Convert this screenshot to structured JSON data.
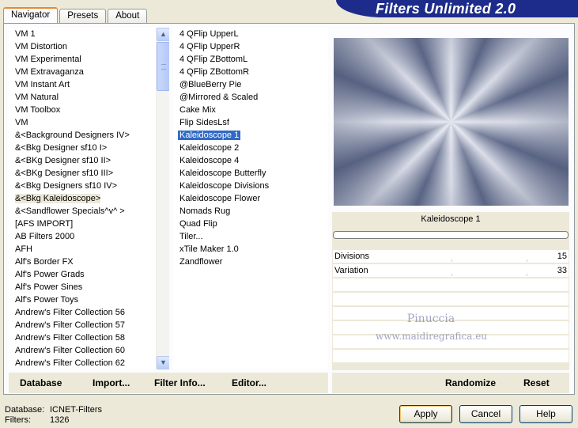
{
  "tabs": [
    {
      "label": "Navigator"
    },
    {
      "label": "Presets"
    },
    {
      "label": "About"
    }
  ],
  "banner": {
    "title": "Filters Unlimited 2.0"
  },
  "categories": [
    "VM 1",
    "VM Distortion",
    "VM Experimental",
    "VM Extravaganza",
    "VM Instant Art",
    "VM Natural",
    "VM Toolbox",
    "VM",
    "&<Background Designers IV>",
    "&<Bkg Designer sf10 I>",
    "&<BKg Designer sf10 II>",
    "&<BKg Designer sf10 III>",
    "&<Bkg Designers sf10 IV>",
    "&<Bkg Kaleidoscope>",
    "&<Sandflower Specials^v^ >",
    "[AFS IMPORT]",
    "AB Filters 2000",
    "AFH",
    "Alf's Border FX",
    "Alf's Power Grads",
    "Alf's Power Sines",
    "Alf's Power Toys",
    "Andrew's Filter Collection 56",
    "Andrew's Filter Collection 57",
    "Andrew's Filter Collection 58",
    "Andrew's Filter Collection 60",
    "Andrew's Filter Collection 62"
  ],
  "filters": [
    "4 QFlip UpperL",
    "4 QFlip UpperR",
    "4 QFlip ZBottomL",
    "4 QFlip ZBottomR",
    "@BlueBerry Pie",
    "@Mirrored & Scaled",
    "Cake Mix",
    "Flip SidesLsf",
    "Kaleidoscope 1",
    "Kaleidoscope 2",
    "Kaleidoscope 4",
    "Kaleidoscope Butterfly",
    "Kaleidoscope Divisions",
    "Kaleidoscope Flower",
    "Nomads Rug",
    "Quad Flip",
    "Tiler...",
    "xTile Maker 1.0",
    "Zandflower"
  ],
  "selected_category": "&<Bkg Kaleidoscope>",
  "selected_filter": "Kaleidoscope 1",
  "params": {
    "filter_name": "Kaleidoscope 1",
    "rows": [
      {
        "name": "Divisions",
        "value": "15"
      },
      {
        "name": "Variation",
        "value": "33"
      }
    ]
  },
  "watermark": {
    "line1": "Pinuccia",
    "line2": "www.maidiregrafica.eu"
  },
  "left_buttons": {
    "database": "Database",
    "import": "Import...",
    "filter_info": "Filter Info...",
    "editor": "Editor..."
  },
  "right_buttons": {
    "randomize": "Randomize",
    "reset": "Reset"
  },
  "status": {
    "database_label": "Database:",
    "database_value": "ICNET-Filters",
    "filters_label": "Filters:",
    "filters_value": "1326"
  },
  "dialog_buttons": {
    "apply": "Apply",
    "cancel": "Cancel",
    "help": "Help"
  },
  "colors": {
    "title_banner": "#1d2c8a",
    "selection": "#316ac5",
    "tab_accent": "#e68b2c"
  }
}
